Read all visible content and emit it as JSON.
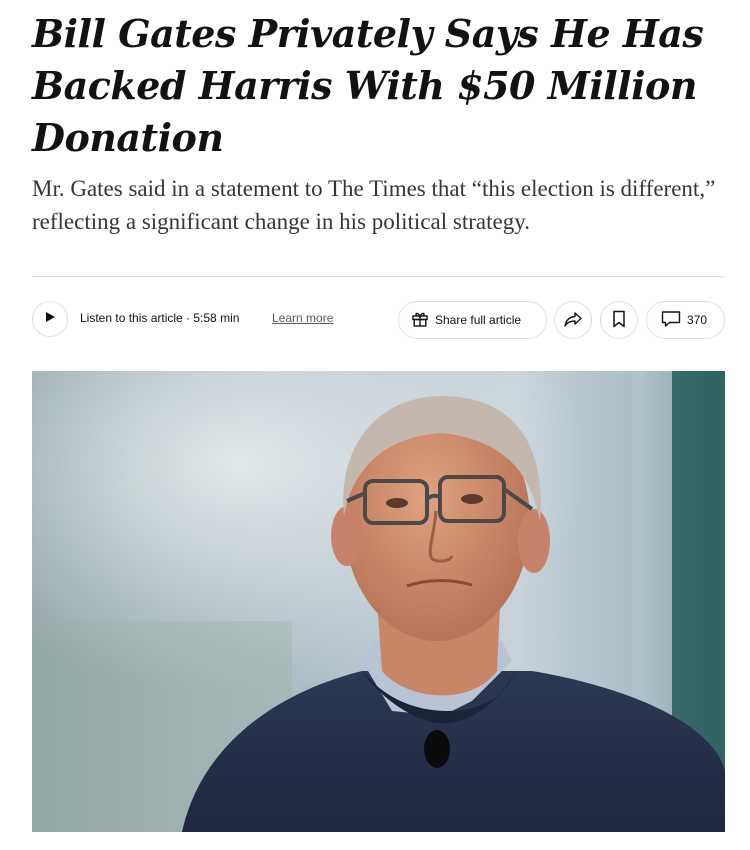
{
  "article": {
    "headline": "Bill Gates Privately Says He Has Backed Harris With $50 Million Donation",
    "summary": "Mr. Gates said in a statement to The Times that “this election is different,” reflecting a significant change in his political strategy."
  },
  "toolbar": {
    "listen_label": "Listen to this article · 5:58 min",
    "learn_more": "Learn more",
    "share_label": "Share full article",
    "comment_count": "370"
  },
  "icons": {
    "play": "play-icon",
    "gift": "gift-icon",
    "forward": "share-arrow-icon",
    "bookmark": "bookmark-icon",
    "comment": "comment-icon"
  },
  "colors": {
    "text": "#121212",
    "summary": "#363636",
    "border": "#dfdfdf",
    "sweater": "#25304a"
  }
}
